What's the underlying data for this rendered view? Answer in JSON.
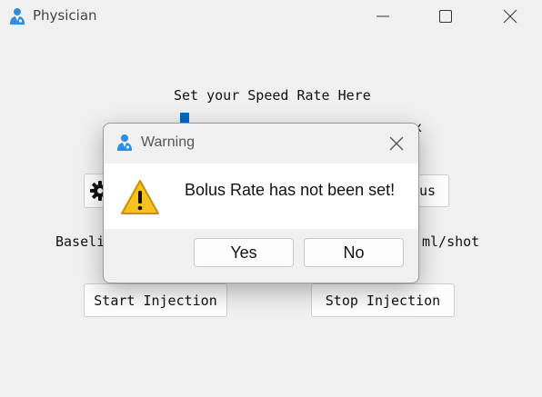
{
  "window": {
    "title": "Physician",
    "icon": "physician-icon",
    "controls": [
      "minimize-icon",
      "maximize-icon",
      "close-icon"
    ]
  },
  "main": {
    "speed_label": "Set your Speed Rate Here",
    "speed_suffix_fragment": "x",
    "settings_icon": "gear-icon",
    "bolus_button_fragment": "us",
    "baseline_fragment": "Baseli",
    "bolus_unit_fragment": "ml/shot",
    "start_button": "Start Injection",
    "stop_button": "Stop Injection"
  },
  "dialog": {
    "title": "Warning",
    "icon": "physician-icon",
    "message_icon": "warning-icon",
    "message": "Bolus Rate has not been set!",
    "yes_label": "Yes",
    "no_label": "No"
  },
  "colors": {
    "accent": "#0067c0",
    "warning_fill": "#f7c21e",
    "icon_blue": "#2f8ee0"
  }
}
